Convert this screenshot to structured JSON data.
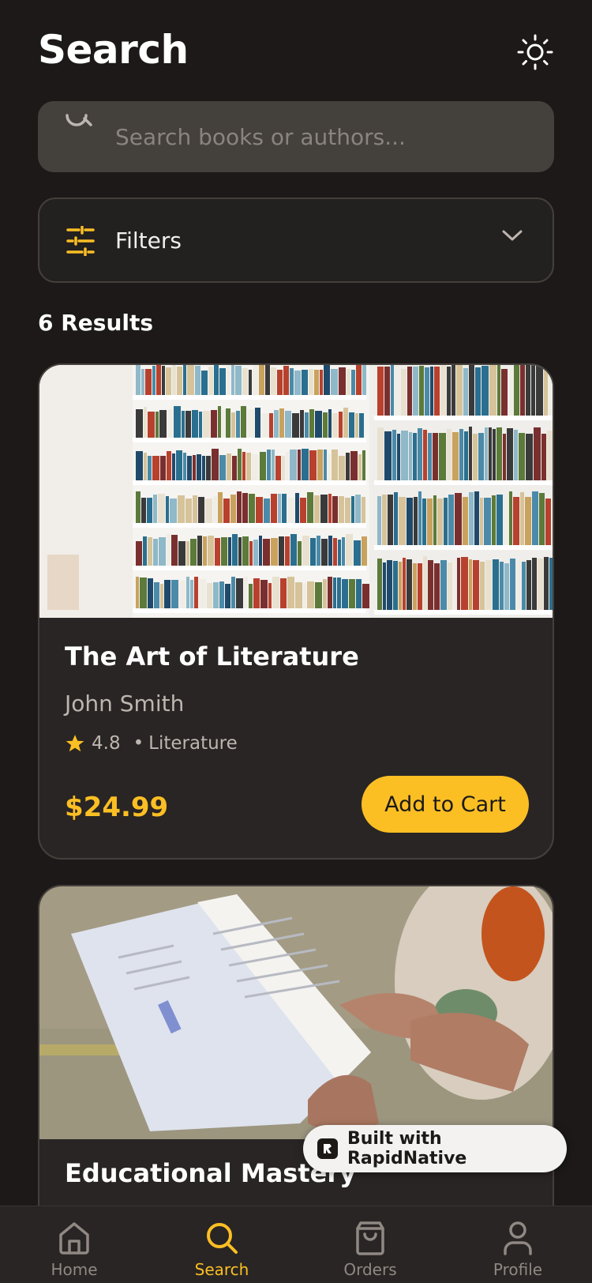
{
  "header": {
    "title": "Search",
    "theme_icon": "sun-icon"
  },
  "search": {
    "placeholder": "Search books or authors...",
    "value": ""
  },
  "filters": {
    "label": "Filters"
  },
  "results": {
    "count_label": "6 Results"
  },
  "books": [
    {
      "title": "The Art of Literature",
      "author": "John Smith",
      "rating": "4.8",
      "category": "Literature",
      "price": "$24.99",
      "button_label": "Add to Cart"
    },
    {
      "title": "Educational Mastery"
    }
  ],
  "badge": {
    "label": "Built with RapidNative"
  },
  "tabs": [
    {
      "label": "Home",
      "icon": "home-icon",
      "active": false
    },
    {
      "label": "Search",
      "icon": "search-icon",
      "active": true
    },
    {
      "label": "Orders",
      "icon": "shopping-bag-icon",
      "active": false
    },
    {
      "label": "Profile",
      "icon": "user-icon",
      "active": false
    }
  ],
  "colors": {
    "background": "#1c1918",
    "card": "#292524",
    "accent": "#fbbf24",
    "muted_text": "#bdb6b0"
  }
}
